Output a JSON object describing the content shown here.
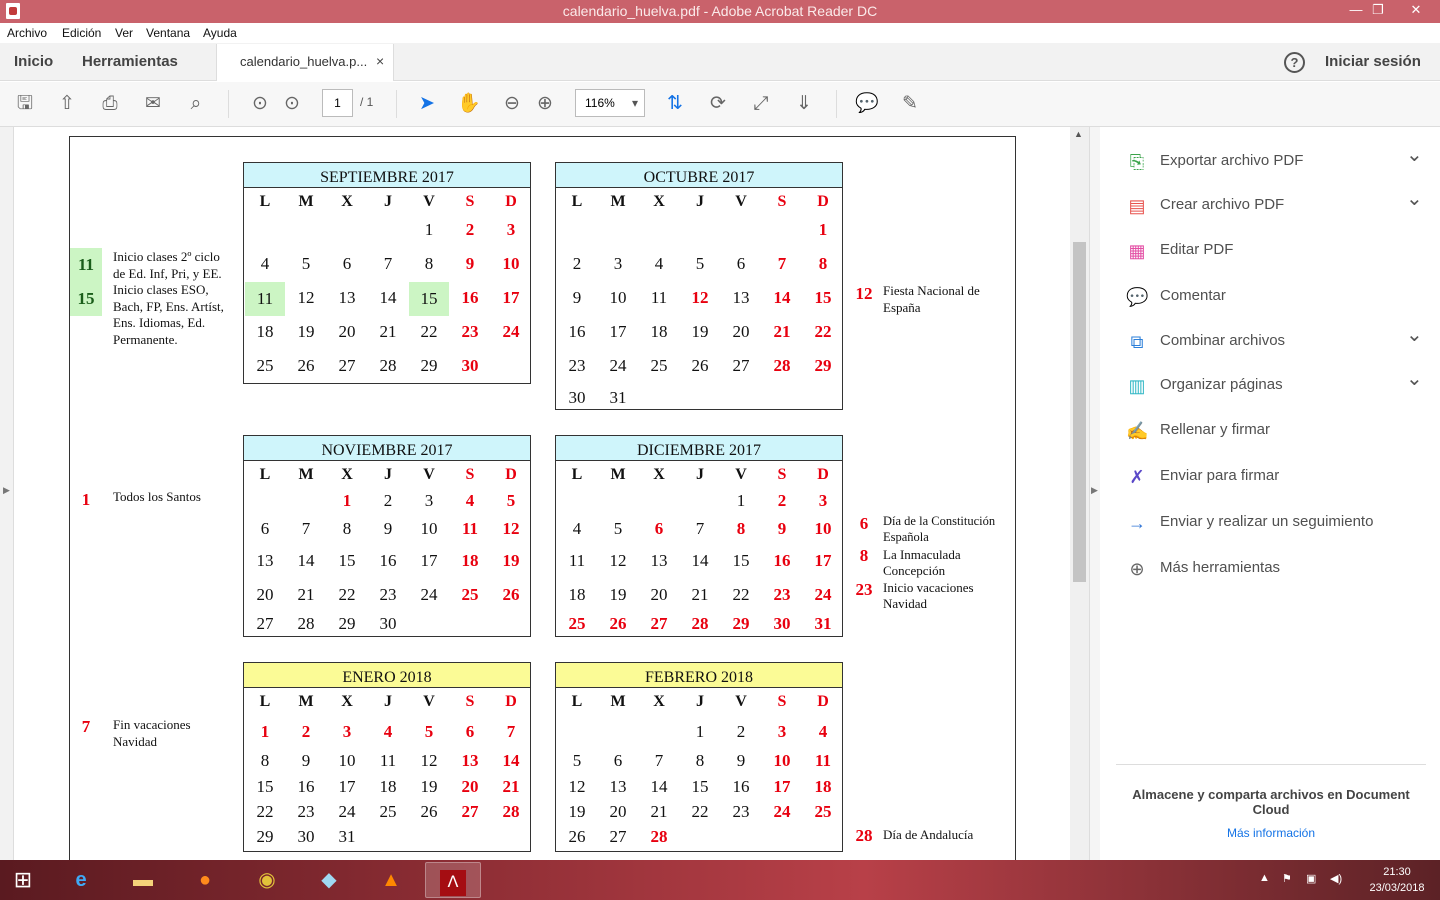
{
  "window": {
    "title": "calendario_huelva.pdf - Adobe Acrobat Reader DC",
    "min": "—",
    "max": "❐",
    "close": "✕"
  },
  "menu": [
    "Archivo",
    "Edición",
    "Ver",
    "Ventana",
    "Ayuda"
  ],
  "nav": {
    "home": "Inicio",
    "tools": "Herramientas",
    "tab": "calendario_huelva.p...",
    "tab_close": "×",
    "help": "?",
    "signin": "Iniciar sesión"
  },
  "toolbar": {
    "page": "1",
    "page_total": "/ 1",
    "zoom": "116%"
  },
  "calendars": [
    {
      "title": "SEPTIEMBRE 2017",
      "bg": "#cff5fb",
      "rows": [
        [
          "",
          "",
          "",
          "",
          "1",
          "2",
          "3"
        ],
        [
          "4",
          "5",
          "6",
          "7",
          "8",
          "9",
          "10"
        ],
        [
          "11",
          "12",
          "13",
          "14",
          "15",
          "16",
          "17"
        ],
        [
          "18",
          "19",
          "20",
          "21",
          "22",
          "23",
          "24"
        ],
        [
          "25",
          "26",
          "27",
          "28",
          "29",
          "30",
          ""
        ]
      ],
      "red_extra": [],
      "highlight": [
        "11",
        "15"
      ]
    },
    {
      "title": "OCTUBRE 2017",
      "bg": "#cff5fb",
      "rows": [
        [
          "",
          "",
          "",
          "",
          "",
          "",
          "1"
        ],
        [
          "2",
          "3",
          "4",
          "5",
          "6",
          "7",
          "8"
        ],
        [
          "9",
          "10",
          "11",
          "12",
          "13",
          "14",
          "15"
        ],
        [
          "16",
          "17",
          "18",
          "19",
          "20",
          "21",
          "22"
        ],
        [
          "23",
          "24",
          "25",
          "26",
          "27",
          "28",
          "29"
        ],
        [
          "30",
          "31",
          "",
          "",
          "",
          "",
          ""
        ]
      ],
      "red_extra": [
        "12"
      ],
      "highlight": []
    },
    {
      "title": "NOVIEMBRE 2017",
      "bg": "#cff5fb",
      "rows": [
        [
          "",
          "",
          "1",
          "2",
          "3",
          "4",
          "5"
        ],
        [
          "6",
          "7",
          "8",
          "9",
          "10",
          "11",
          "12"
        ],
        [
          "13",
          "14",
          "15",
          "16",
          "17",
          "18",
          "19"
        ],
        [
          "20",
          "21",
          "22",
          "23",
          "24",
          "25",
          "26"
        ],
        [
          "27",
          "28",
          "29",
          "30",
          "",
          "",
          ""
        ]
      ],
      "red_extra": [
        "1"
      ],
      "highlight": []
    },
    {
      "title": "DICIEMBRE 2017",
      "bg": "#cff5fb",
      "rows": [
        [
          "",
          "",
          "",
          "",
          "1",
          "2",
          "3"
        ],
        [
          "4",
          "5",
          "6",
          "7",
          "8",
          "9",
          "10"
        ],
        [
          "11",
          "12",
          "13",
          "14",
          "15",
          "16",
          "17"
        ],
        [
          "18",
          "19",
          "20",
          "21",
          "22",
          "23",
          "24"
        ],
        [
          "25",
          "26",
          "27",
          "28",
          "29",
          "30",
          "31"
        ]
      ],
      "red_extra": [
        "6",
        "8",
        "25",
        "26",
        "27",
        "28",
        "29"
      ],
      "highlight": []
    },
    {
      "title": "ENERO 2018",
      "bg": "#fbfb96",
      "rows": [
        [
          "1",
          "2",
          "3",
          "4",
          "5",
          "6",
          "7"
        ],
        [
          "8",
          "9",
          "10",
          "11",
          "12",
          "13",
          "14"
        ],
        [
          "15",
          "16",
          "17",
          "18",
          "19",
          "20",
          "21"
        ],
        [
          "22",
          "23",
          "24",
          "25",
          "26",
          "27",
          "28"
        ],
        [
          "29",
          "30",
          "31",
          "",
          "",
          "",
          ""
        ]
      ],
      "red_extra": [
        "1",
        "2",
        "3",
        "4",
        "5"
      ],
      "highlight": []
    },
    {
      "title": "FEBRERO 2018",
      "bg": "#fbfb96",
      "rows": [
        [
          "",
          "",
          "",
          "1",
          "2",
          "3",
          "4"
        ],
        [
          "5",
          "6",
          "7",
          "8",
          "9",
          "10",
          "11"
        ],
        [
          "12",
          "13",
          "14",
          "15",
          "16",
          "17",
          "18"
        ],
        [
          "19",
          "20",
          "21",
          "22",
          "23",
          "24",
          "25"
        ],
        [
          "26",
          "27",
          "28",
          "",
          "",
          "",
          ""
        ]
      ],
      "red_extra": [
        "28"
      ],
      "highlight": []
    }
  ],
  "weekdays": [
    "L",
    "M",
    "X",
    "J",
    "V",
    "S",
    "D"
  ],
  "events": {
    "sep_num1": "11",
    "sep_num2": "15",
    "sep_text": [
      "Inicio clases  2º ciclo",
      "de Ed. Inf, Pri, y EE.",
      "Inicio clases ESO,",
      "Bach, FP, Ens. Artíst,",
      "Ens. Idiomas, Ed.",
      "Permanente."
    ],
    "oct_num": "12",
    "oct_text": [
      "Fiesta Nacional de",
      "España"
    ],
    "nov_num": "1",
    "nov_text": "Todos los Santos",
    "dic_num1": "6",
    "dic_text1": [
      "Día de la Constitución",
      "Española"
    ],
    "dic_num2": "8",
    "dic_text2": [
      "La Inmaculada",
      "Concepción"
    ],
    "dic_num3": "23",
    "dic_text3": [
      "Inicio vacaciones",
      "Navidad"
    ],
    "ene_num": "7",
    "ene_text": [
      "Fin vacaciones",
      "Navidad"
    ],
    "feb_num": "28",
    "feb_text": "Día de Andalucía"
  },
  "right_panel": [
    {
      "label": "Exportar archivo PDF",
      "icon": "export-pdf-icon",
      "color": "#3aa34a",
      "chevron": true
    },
    {
      "label": "Crear archivo PDF",
      "icon": "create-pdf-icon",
      "color": "#e8534e",
      "chevron": true
    },
    {
      "label": "Editar PDF",
      "icon": "edit-pdf-icon",
      "color": "#e34ea4",
      "chevron": false
    },
    {
      "label": "Comentar",
      "icon": "comment-icon",
      "color": "#f4bb20",
      "chevron": false
    },
    {
      "label": "Combinar archivos",
      "icon": "combine-icon",
      "color": "#2b7fd9",
      "chevron": true
    },
    {
      "label": "Organizar páginas",
      "icon": "organize-icon",
      "color": "#31b7c5",
      "chevron": true
    },
    {
      "label": "Rellenar y firmar",
      "icon": "fill-sign-icon",
      "color": "#7a5be0",
      "chevron": false
    },
    {
      "label": "Enviar para firmar",
      "icon": "send-sign-icon",
      "color": "#5a48c8",
      "chevron": false
    },
    {
      "label": "Enviar y realizar un seguimiento",
      "icon": "send-track-icon",
      "color": "#2f74d6",
      "chevron": false
    },
    {
      "label": "Más herramientas",
      "icon": "more-tools-icon",
      "color": "#666666",
      "chevron": false
    }
  ],
  "panel_footer": {
    "text": "Almacene y comparta archivos en Document Cloud",
    "link": "Más información"
  },
  "taskbar": {
    "time": "21:30",
    "date": "23/03/2018"
  }
}
